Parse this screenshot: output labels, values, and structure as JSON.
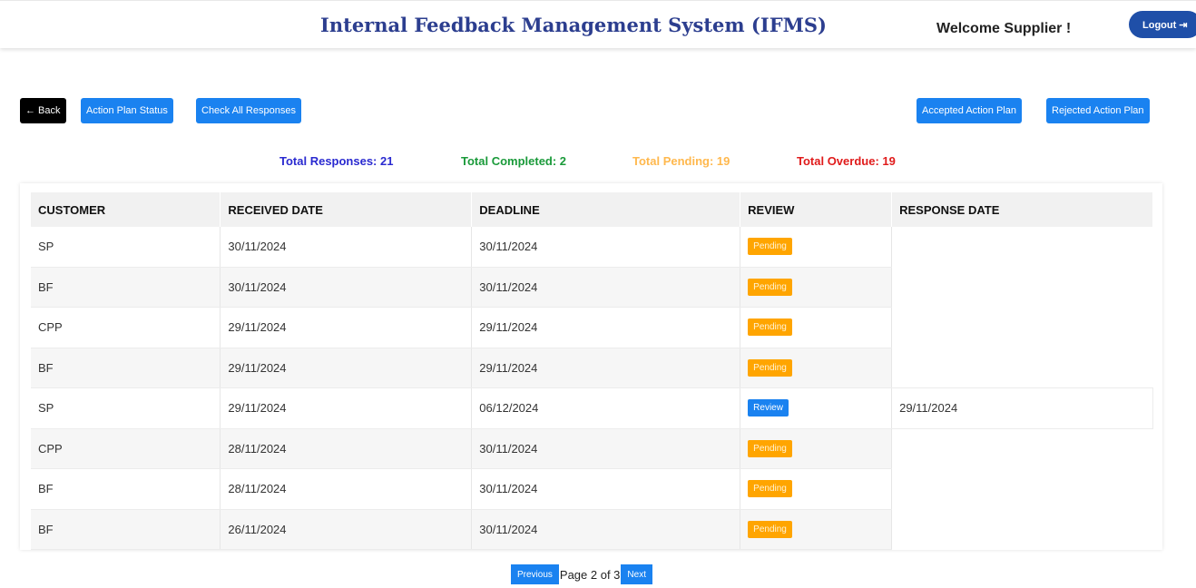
{
  "header": {
    "title": "Internal Feedback Management System (IFMS)",
    "welcome": "Welcome Supplier !",
    "logout_label": "Logout",
    "logout_icon": "sign-out-icon"
  },
  "toolbar": {
    "back_label": "← Back",
    "action_plan_status_label": "Action Plan Status",
    "check_all_responses_label": "Check All Responses",
    "accepted_action_plan_label": "Accepted Action Plan",
    "rejected_action_plan_label": "Rejected Action Plan"
  },
  "stats": {
    "total_responses": "Total Responses: 21",
    "total_completed": "Total Completed: 2",
    "total_pending": "Total Pending: 19",
    "total_overdue": "Total Overdue: 19"
  },
  "colors": {
    "title": "#2c3e8f",
    "responses": "#2a2ad0",
    "completed": "#1a9a3a",
    "pending": "#ffb84d",
    "overdue": "#e01b1b",
    "blue_button": "#1a82f0",
    "pending_badge": "#ffa500",
    "logout": "#1f4fa8"
  },
  "table": {
    "headers": [
      "CUSTOMER",
      "RECEIVED DATE",
      "DEADLINE",
      "REVIEW",
      "RESPONSE DATE"
    ],
    "rows": [
      {
        "customer": "SP",
        "received": "30/11/2024",
        "deadline": "30/11/2024",
        "review": "Pending",
        "response_date": ""
      },
      {
        "customer": "BF",
        "received": "30/11/2024",
        "deadline": "30/11/2024",
        "review": "Pending",
        "response_date": ""
      },
      {
        "customer": "CPP",
        "received": "29/11/2024",
        "deadline": "29/11/2024",
        "review": "Pending",
        "response_date": ""
      },
      {
        "customer": "BF",
        "received": "29/11/2024",
        "deadline": "29/11/2024",
        "review": "Pending",
        "response_date": ""
      },
      {
        "customer": "SP",
        "received": "29/11/2024",
        "deadline": "06/12/2024",
        "review": "Review",
        "response_date": "29/11/2024"
      },
      {
        "customer": "CPP",
        "received": "28/11/2024",
        "deadline": "30/11/2024",
        "review": "Pending",
        "response_date": ""
      },
      {
        "customer": "BF",
        "received": "28/11/2024",
        "deadline": "30/11/2024",
        "review": "Pending",
        "response_date": ""
      },
      {
        "customer": "BF",
        "received": "26/11/2024",
        "deadline": "30/11/2024",
        "review": "Pending",
        "response_date": ""
      }
    ]
  },
  "pagination": {
    "previous_label": "Previous",
    "page_info": "Page 2 of 3",
    "next_label": "Next"
  }
}
